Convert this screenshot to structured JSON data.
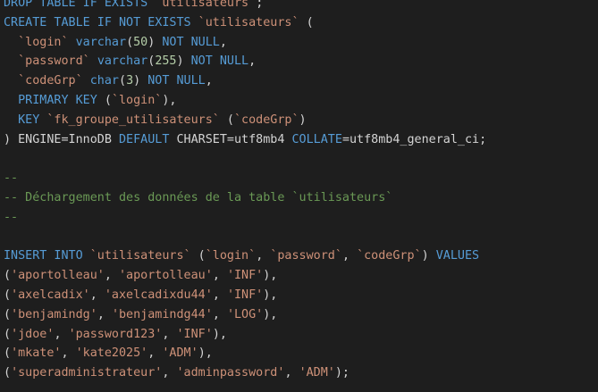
{
  "editor": {
    "language": "sql",
    "theme_colors": {
      "background": "#1e1e1e",
      "keyword": "#569cd6",
      "string": "#ce9178",
      "number": "#b5cea8",
      "comment": "#6a9955",
      "text": "#d4d4d4",
      "function": "#dcdcaa"
    },
    "lines": [
      {
        "tokens": [
          {
            "t": "DROP TABLE IF EXISTS ",
            "k": "kw"
          },
          {
            "t": "`utilisateurs`",
            "k": "str"
          },
          {
            "t": ";",
            "k": "plain"
          }
        ]
      },
      {
        "tokens": [
          {
            "t": "CREATE TABLE IF NOT EXISTS ",
            "k": "kw"
          },
          {
            "t": "`utilisateurs`",
            "k": "str"
          },
          {
            "t": " (",
            "k": "plain"
          }
        ]
      },
      {
        "tokens": [
          {
            "t": "  ",
            "k": "plain"
          },
          {
            "t": "`login`",
            "k": "str"
          },
          {
            "t": " ",
            "k": "plain"
          },
          {
            "t": "varchar",
            "k": "kw"
          },
          {
            "t": "(",
            "k": "plain"
          },
          {
            "t": "50",
            "k": "num"
          },
          {
            "t": ") ",
            "k": "plain"
          },
          {
            "t": "NOT NULL",
            "k": "kw"
          },
          {
            "t": ",",
            "k": "plain"
          }
        ]
      },
      {
        "tokens": [
          {
            "t": "  ",
            "k": "plain"
          },
          {
            "t": "`password`",
            "k": "str"
          },
          {
            "t": " ",
            "k": "plain"
          },
          {
            "t": "varchar",
            "k": "kw"
          },
          {
            "t": "(",
            "k": "plain"
          },
          {
            "t": "255",
            "k": "num"
          },
          {
            "t": ") ",
            "k": "plain"
          },
          {
            "t": "NOT NULL",
            "k": "kw"
          },
          {
            "t": ",",
            "k": "plain"
          }
        ]
      },
      {
        "tokens": [
          {
            "t": "  ",
            "k": "plain"
          },
          {
            "t": "`codeGrp`",
            "k": "str"
          },
          {
            "t": " ",
            "k": "plain"
          },
          {
            "t": "char",
            "k": "kw"
          },
          {
            "t": "(",
            "k": "plain"
          },
          {
            "t": "3",
            "k": "num"
          },
          {
            "t": ") ",
            "k": "plain"
          },
          {
            "t": "NOT NULL",
            "k": "kw"
          },
          {
            "t": ",",
            "k": "plain"
          }
        ]
      },
      {
        "tokens": [
          {
            "t": "  ",
            "k": "plain"
          },
          {
            "t": "PRIMARY KEY",
            "k": "kw"
          },
          {
            "t": " (",
            "k": "plain"
          },
          {
            "t": "`login`",
            "k": "str"
          },
          {
            "t": "),",
            "k": "plain"
          }
        ]
      },
      {
        "tokens": [
          {
            "t": "  ",
            "k": "plain"
          },
          {
            "t": "KEY",
            "k": "kw"
          },
          {
            "t": " ",
            "k": "plain"
          },
          {
            "t": "`fk_groupe_utilisateurs`",
            "k": "str"
          },
          {
            "t": " (",
            "k": "plain"
          },
          {
            "t": "`codeGrp`",
            "k": "str"
          },
          {
            "t": ")",
            "k": "plain"
          }
        ]
      },
      {
        "tokens": [
          {
            "t": ") ENGINE=InnoDB ",
            "k": "plain"
          },
          {
            "t": "DEFAULT",
            "k": "kw"
          },
          {
            "t": " CHARSET=utf8mb4 ",
            "k": "plain"
          },
          {
            "t": "COLLATE",
            "k": "kw"
          },
          {
            "t": "=utf8mb4_general_ci;",
            "k": "plain"
          }
        ]
      },
      {
        "tokens": []
      },
      {
        "tokens": [
          {
            "t": "--",
            "k": "cmt"
          }
        ]
      },
      {
        "tokens": [
          {
            "t": "-- Déchargement des données de la table `utilisateurs`",
            "k": "cmt"
          }
        ]
      },
      {
        "tokens": [
          {
            "t": "--",
            "k": "cmt"
          }
        ]
      },
      {
        "tokens": []
      },
      {
        "tokens": [
          {
            "t": "INSERT INTO ",
            "k": "kw"
          },
          {
            "t": "`utilisateurs`",
            "k": "str"
          },
          {
            "t": " (",
            "k": "plain"
          },
          {
            "t": "`login`",
            "k": "str"
          },
          {
            "t": ", ",
            "k": "plain"
          },
          {
            "t": "`password`",
            "k": "str"
          },
          {
            "t": ", ",
            "k": "plain"
          },
          {
            "t": "`codeGrp`",
            "k": "str"
          },
          {
            "t": ") ",
            "k": "plain"
          },
          {
            "t": "VALUES",
            "k": "kw"
          }
        ]
      },
      {
        "tokens": [
          {
            "t": "(",
            "k": "plain"
          },
          {
            "t": "'aportolleau'",
            "k": "str"
          },
          {
            "t": ", ",
            "k": "plain"
          },
          {
            "t": "'aportolleau'",
            "k": "str"
          },
          {
            "t": ", ",
            "k": "plain"
          },
          {
            "t": "'INF'",
            "k": "str"
          },
          {
            "t": "),",
            "k": "plain"
          }
        ]
      },
      {
        "tokens": [
          {
            "t": "(",
            "k": "plain"
          },
          {
            "t": "'axelcadix'",
            "k": "str"
          },
          {
            "t": ", ",
            "k": "plain"
          },
          {
            "t": "'axelcadixdu44'",
            "k": "str"
          },
          {
            "t": ", ",
            "k": "plain"
          },
          {
            "t": "'INF'",
            "k": "str"
          },
          {
            "t": "),",
            "k": "plain"
          }
        ]
      },
      {
        "tokens": [
          {
            "t": "(",
            "k": "plain"
          },
          {
            "t": "'benjamindg'",
            "k": "str"
          },
          {
            "t": ", ",
            "k": "plain"
          },
          {
            "t": "'benjamindg44'",
            "k": "str"
          },
          {
            "t": ", ",
            "k": "plain"
          },
          {
            "t": "'LOG'",
            "k": "str"
          },
          {
            "t": "),",
            "k": "plain"
          }
        ]
      },
      {
        "tokens": [
          {
            "t": "(",
            "k": "plain"
          },
          {
            "t": "'jdoe'",
            "k": "str"
          },
          {
            "t": ", ",
            "k": "plain"
          },
          {
            "t": "'password123'",
            "k": "str"
          },
          {
            "t": ", ",
            "k": "plain"
          },
          {
            "t": "'INF'",
            "k": "str"
          },
          {
            "t": "),",
            "k": "plain"
          }
        ]
      },
      {
        "tokens": [
          {
            "t": "(",
            "k": "plain"
          },
          {
            "t": "'mkate'",
            "k": "str"
          },
          {
            "t": ", ",
            "k": "plain"
          },
          {
            "t": "'kate2025'",
            "k": "str"
          },
          {
            "t": ", ",
            "k": "plain"
          },
          {
            "t": "'ADM'",
            "k": "str"
          },
          {
            "t": "),",
            "k": "plain"
          }
        ]
      },
      {
        "tokens": [
          {
            "t": "(",
            "k": "plain"
          },
          {
            "t": "'superadministrateur'",
            "k": "str"
          },
          {
            "t": ", ",
            "k": "plain"
          },
          {
            "t": "'adminpassword'",
            "k": "str"
          },
          {
            "t": ", ",
            "k": "plain"
          },
          {
            "t": "'ADM'",
            "k": "str"
          },
          {
            "t": ");",
            "k": "plain"
          }
        ]
      }
    ]
  }
}
